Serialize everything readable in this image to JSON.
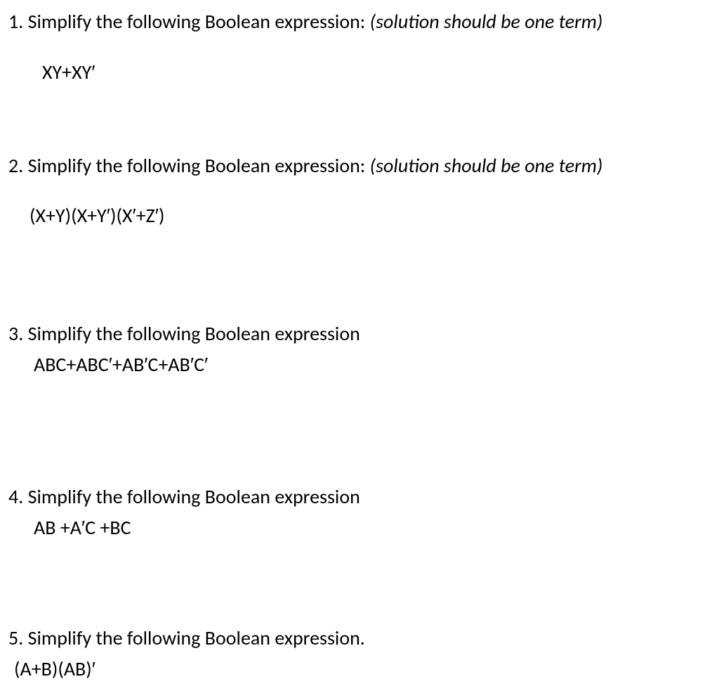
{
  "questions": [
    {
      "number": "1.",
      "prompt": "Simplify the following Boolean expression:",
      "hint": "(solution should be one term)",
      "expression": "XY+XY′"
    },
    {
      "number": "2.",
      "prompt": "Simplify the following Boolean expression:",
      "hint": "(solution should be one term)",
      "expression": "(X+Y)(X+Y′)(X′+Z′)"
    },
    {
      "number": "3.",
      "prompt": "Simplify the following Boolean expression",
      "hint": "",
      "expression": "ABC+ABC′+AB′C+AB′C′"
    },
    {
      "number": "4.",
      "prompt": "Simplify the following Boolean expression",
      "hint": "",
      "expression": "AB +A′C +BC"
    },
    {
      "number": "5.",
      "prompt": "Simplify the following Boolean expression.",
      "hint": "",
      "expression": "(A+B)(AB)′"
    }
  ]
}
